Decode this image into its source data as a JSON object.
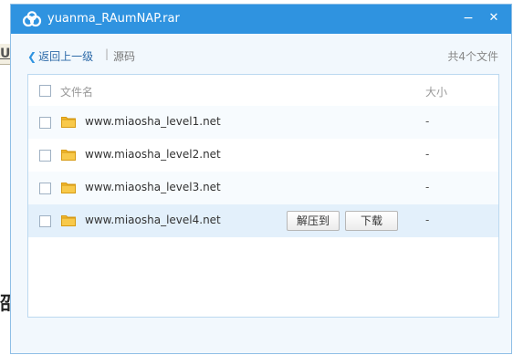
{
  "background": {
    "left_fragment": "U",
    "partial_char": "邵"
  },
  "dialog": {
    "title": "yuanma_RAumNAP.rar",
    "minimize_glyph": "−",
    "close_glyph": "✕",
    "accent_color": "#2f93e0"
  },
  "toolbar": {
    "back_label": "返回上一级",
    "separator": "|",
    "current_folder": "源码",
    "file_count": "共4个文件"
  },
  "table": {
    "columns": {
      "name": "文件名",
      "size": "大小"
    },
    "rows": [
      {
        "name": "www.miaosha_level1.net",
        "size": "-"
      },
      {
        "name": "www.miaosha_level2.net",
        "size": "-"
      },
      {
        "name": "www.miaosha_level3.net",
        "size": "-"
      },
      {
        "name": "www.miaosha_level4.net",
        "size": "-"
      }
    ],
    "hover_actions": {
      "extract": "解压到",
      "download": "下载"
    }
  }
}
